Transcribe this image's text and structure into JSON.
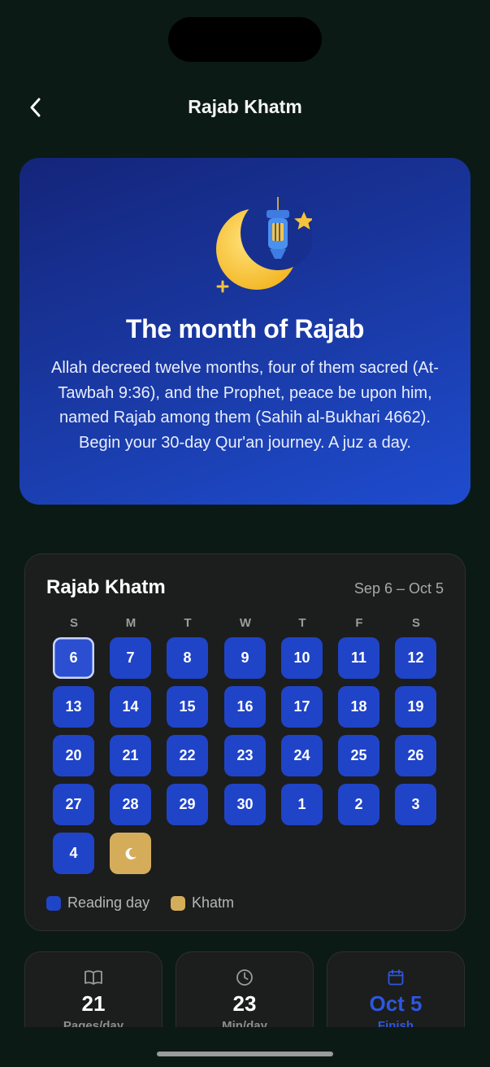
{
  "nav": {
    "title": "Rajab Khatm"
  },
  "hero": {
    "title": "The month of Rajab",
    "body": "Allah decreed twelve months, four of them sacred (At-Tawbah 9:36), and the Prophet, peace be upon him, named Rajab among them (Sahih al-Bukhari 4662). Begin your 30-day Qur'an journey. A juz a day."
  },
  "calendar": {
    "title": "Rajab Khatm",
    "range": "Sep 6 – Oct 5",
    "weekdays": [
      "S",
      "M",
      "T",
      "W",
      "T",
      "F",
      "S"
    ],
    "days": [
      "6",
      "7",
      "8",
      "9",
      "10",
      "11",
      "12",
      "13",
      "14",
      "15",
      "16",
      "17",
      "18",
      "19",
      "20",
      "21",
      "22",
      "23",
      "24",
      "25",
      "26",
      "27",
      "28",
      "29",
      "30",
      "1",
      "2",
      "3",
      "4"
    ],
    "today_index": 0,
    "khatm_icon": "crescent-moon-icon"
  },
  "legend": {
    "reading": "Reading day",
    "khatm": "Khatm"
  },
  "stats": [
    {
      "icon": "book-icon",
      "value": "21",
      "label": "Pages/day"
    },
    {
      "icon": "clock-icon",
      "value": "23",
      "label": "Min/day"
    },
    {
      "icon": "calendar-icon",
      "value": "Oct 5",
      "label": "Finish"
    }
  ],
  "colors": {
    "background": "#0c1a16",
    "reading_day": "#2044c8",
    "khatm": "#d5ad5a",
    "accent": "#2d57e0"
  }
}
